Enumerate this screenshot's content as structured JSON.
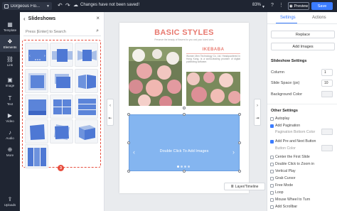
{
  "topbar": {
    "doc_title": "Dorgeous Flo...",
    "save_status": "Changes have not been saved!",
    "zoom": "83%",
    "preview_label": "Preview",
    "save_label": "Save"
  },
  "rail": {
    "items": [
      {
        "label": "Template",
        "icon": "template-icon"
      },
      {
        "label": "Elements",
        "icon": "elements-icon"
      },
      {
        "label": "Link",
        "icon": "link-icon"
      },
      {
        "label": "Image",
        "icon": "image-icon"
      },
      {
        "label": "Text",
        "icon": "text-icon"
      },
      {
        "label": "Video",
        "icon": "video-icon"
      },
      {
        "label": "Audio",
        "icon": "audio-icon"
      },
      {
        "label": "More",
        "icon": "more-icon"
      },
      {
        "label": "Uploads",
        "icon": "uploads-icon"
      }
    ],
    "active": "Elements"
  },
  "panel": {
    "title": "Slideshows",
    "search_placeholder": "Press [Enter] to Search",
    "badge": "3",
    "highlight_color": "#e74c3c"
  },
  "page": {
    "headline": "BASIC STYLES",
    "subline": "Preserve the beauty of flowers for you and your loved ones",
    "brand": "IKEBABA",
    "blurb": "Women Men Technology Co. Ltd. Headquartered in Hong Kong, is a world-leading provider of digital publishing software.",
    "headline_color": "#e8796f"
  },
  "slideshow": {
    "text": "Double Click To Add Images",
    "fill_color": "#84b5f0"
  },
  "layer_button": "Layer/Timeline",
  "right_panel": {
    "tabs": [
      "Settings",
      "Actions"
    ],
    "active_tab": "Settings",
    "replace_label": "Replace",
    "add_images_label": "Add Images",
    "slideshow_settings": "Slideshow Settings",
    "column_label": "Column",
    "column_value": "1",
    "slide_space_label": "Slide Space (px)",
    "slide_space_value": "10",
    "background_color_label": "Background Color",
    "other_settings": "Other Settings",
    "options": [
      {
        "label": "Autoplay",
        "checked": false
      },
      {
        "label": "Add Pagination",
        "checked": true
      },
      {
        "label": "Add Pre and Next Button",
        "checked": true
      },
      {
        "label": "Center the First Slide",
        "checked": false
      },
      {
        "label": "Double Click to Zoom in",
        "checked": false
      },
      {
        "label": "Vertical Play",
        "checked": false
      },
      {
        "label": "Grab Cursor",
        "checked": false
      },
      {
        "label": "Free Mode",
        "checked": false
      },
      {
        "label": "Loop",
        "checked": false
      },
      {
        "label": "Mouse Wheel to Turn",
        "checked": false
      },
      {
        "label": "Add Scrollbar",
        "checked": false
      }
    ],
    "pagination_bottom_color": "Pagination Bottom Color",
    "button_color": "Button Color",
    "accent_color": "#3b7cff"
  }
}
